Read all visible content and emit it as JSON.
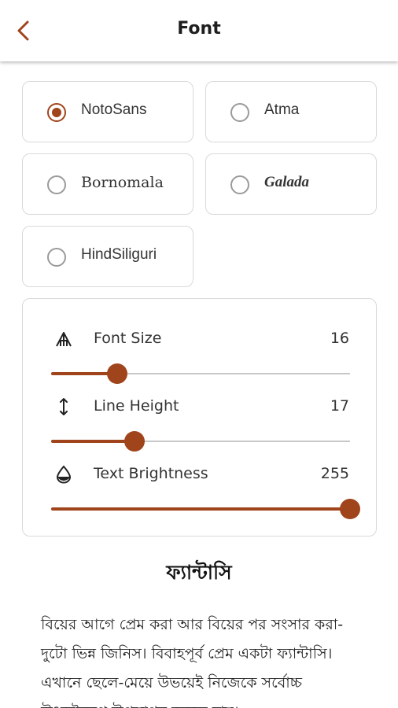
{
  "appbar": {
    "title": "Font",
    "back_icon": "chevron-left-icon"
  },
  "fonts": [
    {
      "label": "NotoSans",
      "selected": true
    },
    {
      "label": "Atma",
      "selected": false
    },
    {
      "label": "Bornomala",
      "selected": false
    },
    {
      "label": "Galada",
      "selected": false
    },
    {
      "label": "HindSiliguri",
      "selected": false
    }
  ],
  "settings": {
    "font_size": {
      "label": "Font Size",
      "value": "16",
      "icon": "text-size-icon",
      "fraction": 0.22
    },
    "line_height": {
      "label": "Line Height",
      "value": "17",
      "icon": "line-height-icon",
      "fraction": 0.28
    },
    "text_brightness": {
      "label": "Text Brightness",
      "value": "255",
      "icon": "brightness-drop-icon",
      "fraction": 1.0
    }
  },
  "preview": {
    "title": "ফ্যান্টাসি",
    "body": "বিয়ের আগে প্রেম করা আর বিয়ের পর সংসার করা-দুটো ভিন্ন জিনিস। বিবাহপূর্ব প্রেম একটা ফ্যান্টাসি। এখানে ছেলে-মেয়ে উভয়েই নিজেকে সর্বোচ্চ উৎকৃষ্টরূপে উপস্থাপন করতে চায়।"
  },
  "colors": {
    "accent": "#a0441c",
    "border": "#d9d9d9",
    "radio_off": "#9a9a9a"
  }
}
